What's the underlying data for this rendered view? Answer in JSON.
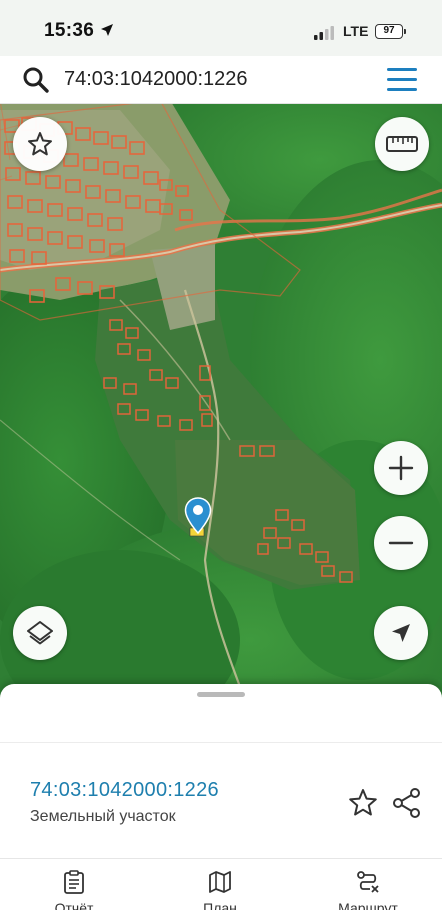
{
  "status_bar": {
    "time": "15:36",
    "network": "LTE",
    "battery_level": "97"
  },
  "search": {
    "query": "74:03:1042000:1226",
    "icon": "search-icon"
  },
  "map": {
    "type": "satellite",
    "pin_color": "#2a8fd0",
    "parcel_outline_color": "#e8643a"
  },
  "map_controls": {
    "favorite": "star-icon",
    "ruler": "ruler-icon",
    "zoom_in": "plus-icon",
    "zoom_out": "minus-icon",
    "layers": "layers-icon",
    "my_location": "navigation-arrow-icon"
  },
  "parcel": {
    "cadastral_number": "74:03:1042000:1226",
    "type": "Земельный участок"
  },
  "actions": [
    {
      "label": "Отчёт",
      "icon": "report-clipboard-icon"
    },
    {
      "label": "План",
      "icon": "map-plan-icon"
    },
    {
      "label": "Маршрут",
      "icon": "route-icon"
    }
  ],
  "colors": {
    "accent": "#1e7fae",
    "menu": "#1d7fbf"
  }
}
